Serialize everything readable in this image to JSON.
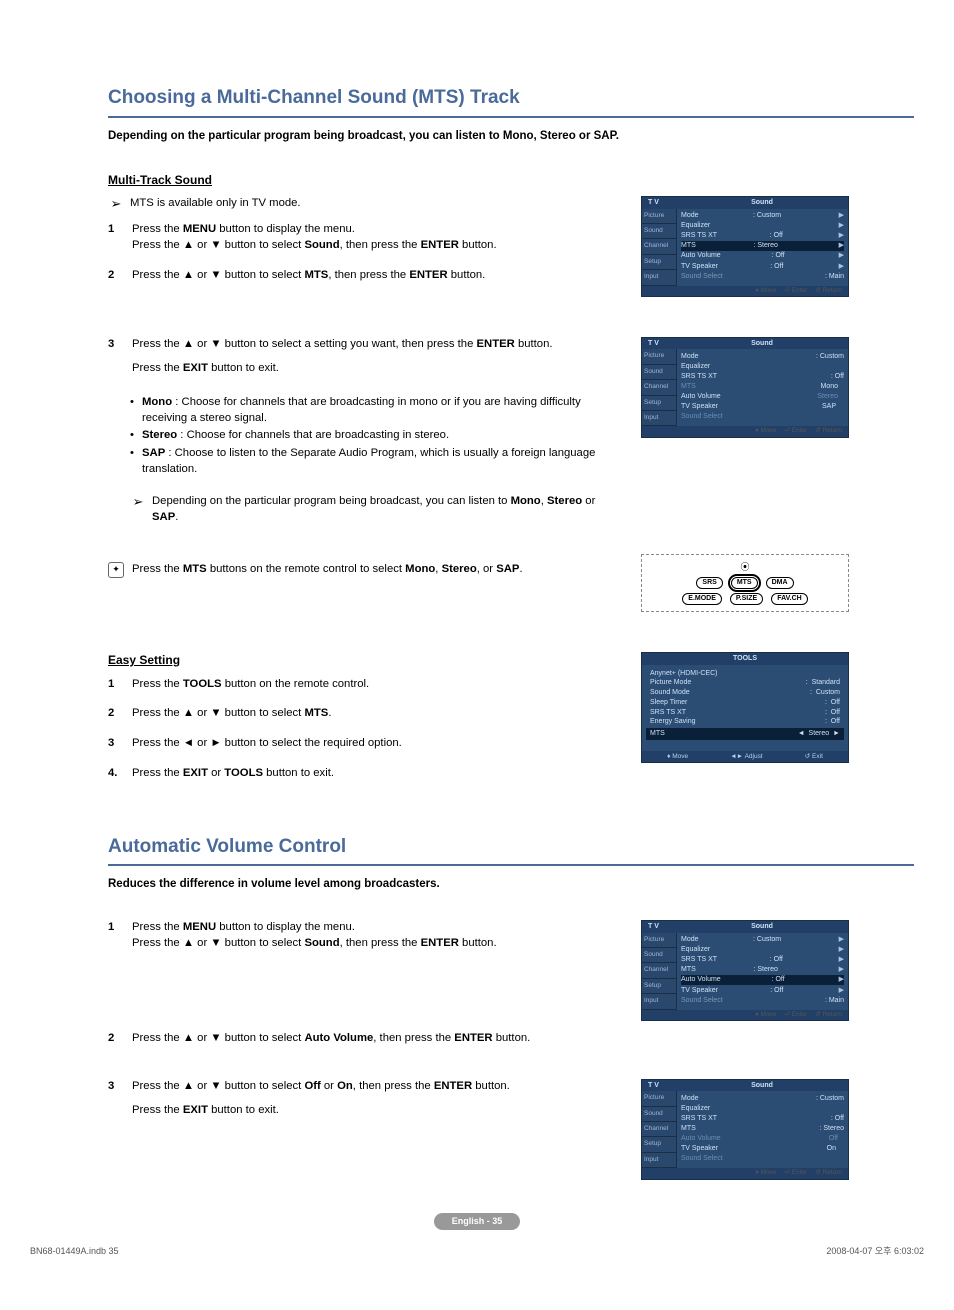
{
  "section1": {
    "title": "Choosing a Multi-Channel Sound (MTS) Track",
    "intro": "Depending on the particular program being broadcast, you can listen to Mono, Stereo or SAP.",
    "subhead": "Multi-Track Sound",
    "note1": "MTS  is available only in TV mode.",
    "step1a": "Press the ",
    "step1_menu": "MENU",
    "step1b": " button to display the menu.",
    "step1c": "Press the ▲ or ▼ button to select ",
    "step1_sound": "Sound",
    "step1d": ", then press the ",
    "step1_enter": "ENTER",
    "step1e": " button.",
    "step2a": "Press the ▲ or ▼ button to select ",
    "step2_mts": "MTS",
    "step2b": ", then press the ",
    "step2_enter": "ENTER",
    "step2c": " button.",
    "step3a": "Press the ▲ or ▼ button to select a setting you want, then press the ",
    "step3_enter": "ENTER",
    "step3b": " button.",
    "step3c": "Press the ",
    "step3_exit": "EXIT",
    "step3d": " button to exit.",
    "mode_mono_l": "Mono",
    "mode_mono_t": " : Choose for channels that are broadcasting in mono or if you are having difficulty receiving a stereo signal.",
    "mode_stereo_l": "Stereo",
    "mode_stereo_t": " : Choose for channels that are broadcasting in stereo.",
    "mode_sap_l": "SAP",
    "mode_sap_t": " : Choose to listen to the Separate Audio Program, which is usually a foreign language translation.",
    "note2a": "Depending on the particular program being broadcast, you can listen to ",
    "note2_mono": "Mono",
    "note2_c1": ", ",
    "note2_stereo": "Stereo",
    "note2_c2": " or ",
    "note2_sap": "SAP",
    "note2_end": ".",
    "tip_a": "Press the ",
    "tip_mts": "MTS",
    "tip_b": " buttons on the remote control to select ",
    "tip_mono": "Mono",
    "tip_c1": ", ",
    "tip_stereo": "Stereo",
    "tip_c2": ", or ",
    "tip_sap": "SAP",
    "tip_end": ".",
    "easy_subhead": "Easy Setting",
    "e1a": "Press the ",
    "e1_tools": "TOOLS",
    "e1b": " button on the remote control.",
    "e2a": "Press the ▲ or ▼ button to select ",
    "e2_mts": "MTS",
    "e2b": ".",
    "e3": "Press the ◄ or ► button to select the required option.",
    "e4a": "Press the ",
    "e4_exit": "EXIT",
    "e4_or": " or ",
    "e4_tools": "TOOLS",
    "e4b": " button to exit."
  },
  "section2": {
    "title": "Automatic Volume Control",
    "intro": "Reduces the difference in volume level among broadcasters.",
    "s1a": "Press the ",
    "s1_menu": "MENU",
    "s1b": " button to display the menu.",
    "s1c": "Press the ▲ or ▼ button to select ",
    "s1_sound": "Sound",
    "s1d": ", then press the ",
    "s1_enter": "ENTER",
    "s1e": " button.",
    "s2a": "Press the ▲ or ▼ button to select ",
    "s2_av": "Auto Volume",
    "s2b": ", then press the ",
    "s2_enter": "ENTER",
    "s2c": " button.",
    "s3a": "Press the ▲ or ▼ button to select ",
    "s3_off": "Off",
    "s3_or": " or ",
    "s3_on": "On",
    "s3b": ", then press the ",
    "s3_enter": "ENTER",
    "s3c": " button.",
    "s3d": "Press the ",
    "s3_exit": "EXIT",
    "s3e": " button to exit."
  },
  "osd": {
    "tv": "T V",
    "sound": "Sound",
    "side": {
      "picture": "Picture",
      "sound": "Sound",
      "channel": "Channel",
      "setup": "Setup",
      "input": "Input"
    },
    "rows": {
      "mode": "Mode",
      "mode_v": ": Custom",
      "eq": "Equalizer",
      "srs": "SRS TS XT",
      "srs_v": ": Off",
      "mts": "MTS",
      "mts_v": ": Stereo",
      "av": "Auto Volume",
      "av_v": ": Off",
      "tvspk": "TV Speaker",
      "tvspk_v": ": Off",
      "ss": "Sound Select",
      "ss_v": ": Main"
    },
    "mts_opts": {
      "mono": "Mono",
      "stereo": "Stereo",
      "sap": "SAP"
    },
    "av_opts": {
      "off": "Off",
      "on": "On"
    },
    "foot": {
      "move": "Move",
      "enter": "Enter",
      "return": "Return"
    }
  },
  "remote": {
    "srs": "SRS",
    "mts": "MTS",
    "dma": "DMA",
    "emode": "E.MODE",
    "psize": "P.SIZE",
    "favch": "FAV.CH"
  },
  "tools": {
    "title": "TOOLS",
    "rows": {
      "anynet": "Anynet+ (HDMI-CEC)",
      "pic": "Picture Mode",
      "pic_v": "Standard",
      "snd": "Sound Mode",
      "snd_v": "Custom",
      "sleep": "Sleep Timer",
      "sleep_v": "Off",
      "srs": "SRS TS XT",
      "srs_v": "Off",
      "es": "Energy Saving",
      "es_v": "Off",
      "mts": "MTS",
      "mts_v": "Stereo"
    },
    "foot": {
      "move": "Move",
      "adjust": "Adjust",
      "exit": "Exit"
    }
  },
  "pagefoot": "English - 35",
  "docfoot_l": "BN68-01449A.indb   35",
  "docfoot_r": "2008-04-07   오후 6:03:02"
}
